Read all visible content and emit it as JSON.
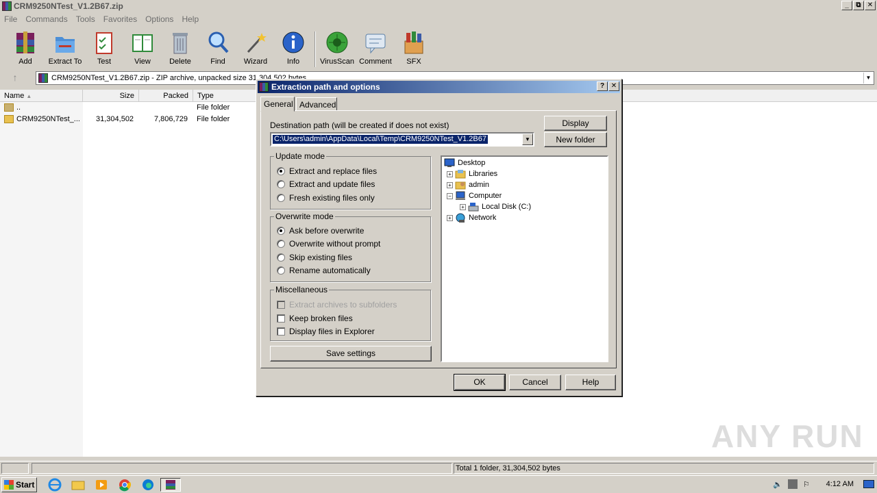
{
  "window": {
    "title": "CRM9250NTest_V1.2B67.zip",
    "buttons": [
      "_",
      "⧉",
      "✕"
    ]
  },
  "menu": [
    "File",
    "Commands",
    "Tools",
    "Favorites",
    "Options",
    "Help"
  ],
  "toolbar": {
    "buttons": [
      {
        "label": "Add",
        "icon": "add-archive-icon"
      },
      {
        "label": "Extract To",
        "icon": "extract-to-icon"
      },
      {
        "label": "Test",
        "icon": "test-icon"
      },
      {
        "label": "View",
        "icon": "view-icon"
      },
      {
        "label": "Delete",
        "icon": "delete-icon"
      },
      {
        "label": "Find",
        "icon": "find-icon"
      },
      {
        "label": "Wizard",
        "icon": "wizard-icon"
      },
      {
        "label": "Info",
        "icon": "info-icon"
      },
      {
        "label": "VirusScan",
        "icon": "virusscan-icon"
      },
      {
        "label": "Comment",
        "icon": "comment-icon"
      },
      {
        "label": "SFX",
        "icon": "sfx-icon"
      }
    ]
  },
  "address": {
    "text": "CRM9250NTest_V1.2B67.zip - ZIP archive, unpacked size 31,304,502 bytes"
  },
  "filelist": {
    "columns": [
      "Name",
      "Size",
      "Packed",
      "Type"
    ],
    "rows": [
      {
        "name": "..",
        "size": "",
        "packed": "",
        "type": "File folder"
      },
      {
        "name": "CRM9250NTest_...",
        "size": "31,304,502",
        "packed": "7,806,729",
        "type": "File folder"
      }
    ]
  },
  "status": {
    "text": "Total 1 folder, 31,304,502 bytes"
  },
  "dialog": {
    "title": "Extraction path and options",
    "help_btn": "?",
    "close_btn": "✕",
    "tabs": [
      "General",
      "Advanced"
    ],
    "dest_label": "Destination path (will be created if does not exist)",
    "dest_value": "C:\\Users\\admin\\AppData\\Local\\Temp\\CRM9250NTest_V1.2B67",
    "display_btn": "Display",
    "newfolder_btn": "New folder",
    "update_mode": {
      "title": "Update mode",
      "options": [
        "Extract and replace files",
        "Extract and update files",
        "Fresh existing files only"
      ],
      "selected": 0
    },
    "overwrite_mode": {
      "title": "Overwrite mode",
      "options": [
        "Ask before overwrite",
        "Overwrite without prompt",
        "Skip existing files",
        "Rename automatically"
      ],
      "selected": 0
    },
    "misc": {
      "title": "Miscellaneous",
      "options": [
        "Extract archives to subfolders",
        "Keep broken files",
        "Display files in Explorer"
      ]
    },
    "save_btn": "Save settings",
    "tree": [
      "Desktop",
      "Libraries",
      "admin",
      "Computer",
      "Local Disk (C:)",
      "Network"
    ],
    "ok": "OK",
    "cancel": "Cancel",
    "help": "Help"
  },
  "taskbar": {
    "start": "Start",
    "clock": "4:12 AM"
  },
  "watermark": "ANY RUN"
}
